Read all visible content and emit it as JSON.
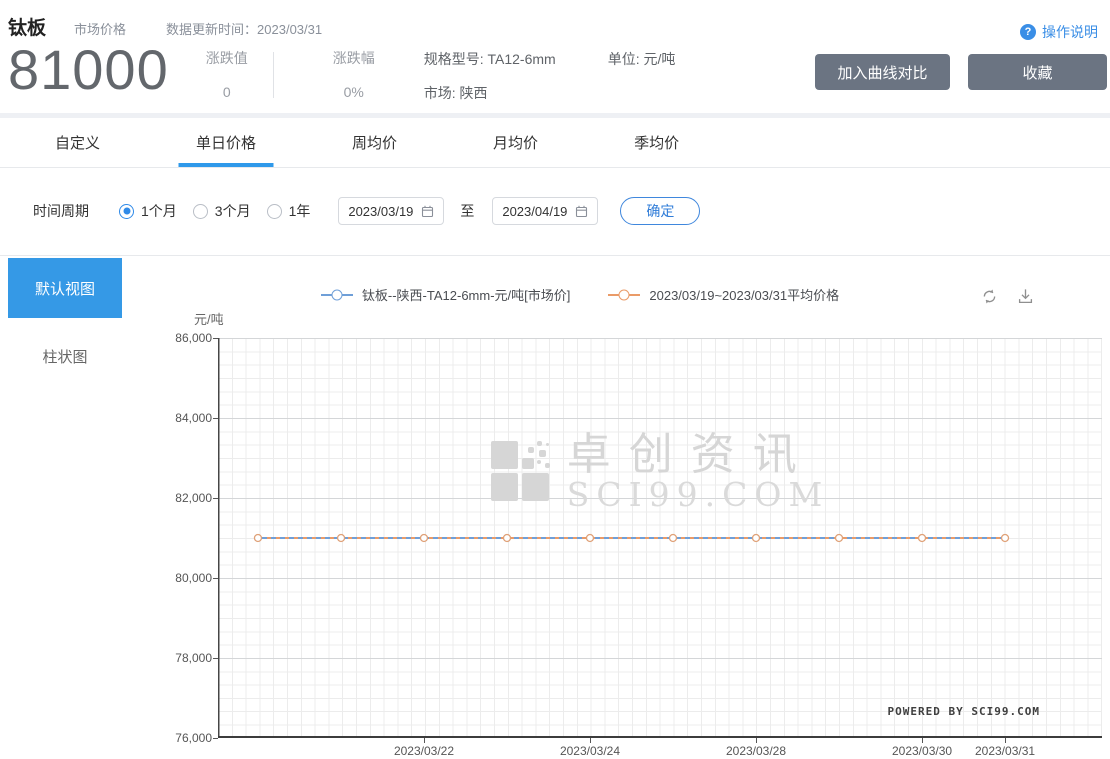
{
  "header": {
    "title": "钛板",
    "subtitle": "市场价格",
    "update_label": "数据更新时间：",
    "update_date": "2023/03/31",
    "help_label": "操作说明",
    "help_icon_glyph": "?",
    "price": "81000",
    "change_label": "涨跌值",
    "change_value": "0",
    "change_pct_label": "涨跌幅",
    "change_pct_value": "0%",
    "spec_label": "规格型号: TA12-6mm",
    "market_label": "市场: 陕西",
    "unit_label": "单位: 元/吨",
    "compare_button": "加入曲线对比",
    "favorite_button": "收藏"
  },
  "tabs": [
    {
      "label": "自定义",
      "active": false
    },
    {
      "label": "单日价格",
      "active": true
    },
    {
      "label": "周均价",
      "active": false
    },
    {
      "label": "月均价",
      "active": false
    },
    {
      "label": "季均价",
      "active": false
    }
  ],
  "filter": {
    "period_label": "时间周期",
    "options": [
      {
        "label": "1个月",
        "selected": true
      },
      {
        "label": "3个月",
        "selected": false
      },
      {
        "label": "1年",
        "selected": false
      }
    ],
    "start_date": "2023/03/19",
    "to_label": "至",
    "end_date": "2023/04/19",
    "confirm_button": "确定"
  },
  "sidebar": {
    "items": [
      {
        "label": "默认视图",
        "active": true
      },
      {
        "label": "柱状图",
        "active": false
      }
    ]
  },
  "colors": {
    "accent_blue": "#2f99ea",
    "link_blue": "#3a8ee6",
    "button_gray": "#6b7482",
    "series_blue": "#6f9fd8",
    "series_orange": "#ea9b68",
    "marker_border": "#dfa178"
  },
  "chart_data": {
    "type": "line",
    "unit_label": "元/吨",
    "legend": [
      {
        "name": "钛板--陕西-TA12-6mm-元/吨[市场价]",
        "color": "#6f9fd8",
        "style": "solid"
      },
      {
        "name": "2023/03/19~2023/03/31平均价格",
        "color": "#ea9b68",
        "style": "dashed"
      }
    ],
    "ylim": [
      76000,
      86000
    ],
    "y_ticks": [
      "86,000",
      "84,000",
      "82,000",
      "80,000",
      "78,000",
      "76,000"
    ],
    "x_tick_labels": [
      "2023/03/22",
      "2023/03/24",
      "2023/03/28",
      "2023/03/30",
      "2023/03/31"
    ],
    "x_tick_fractions": [
      0.233,
      0.4208,
      0.6086,
      0.7964,
      0.8903
    ],
    "point_fractions": [
      0.0452,
      0.1392,
      0.233,
      0.3269,
      0.4208,
      0.5147,
      0.6086,
      0.7025,
      0.7964,
      0.8903
    ],
    "series": [
      {
        "name": "钛板--陕西-TA12-6mm-元/吨[市场价]",
        "values": [
          81000,
          81000,
          81000,
          81000,
          81000,
          81000,
          81000,
          81000,
          81000,
          81000
        ]
      },
      {
        "name": "2023/03/19~2023/03/31平均价格",
        "values": [
          81000,
          81000,
          81000,
          81000,
          81000,
          81000,
          81000,
          81000,
          81000,
          81000
        ]
      }
    ],
    "watermark": {
      "cn": "卓创资讯",
      "en": "SCI99.COM"
    },
    "powered_by": "POWERED BY SCI99.COM"
  }
}
